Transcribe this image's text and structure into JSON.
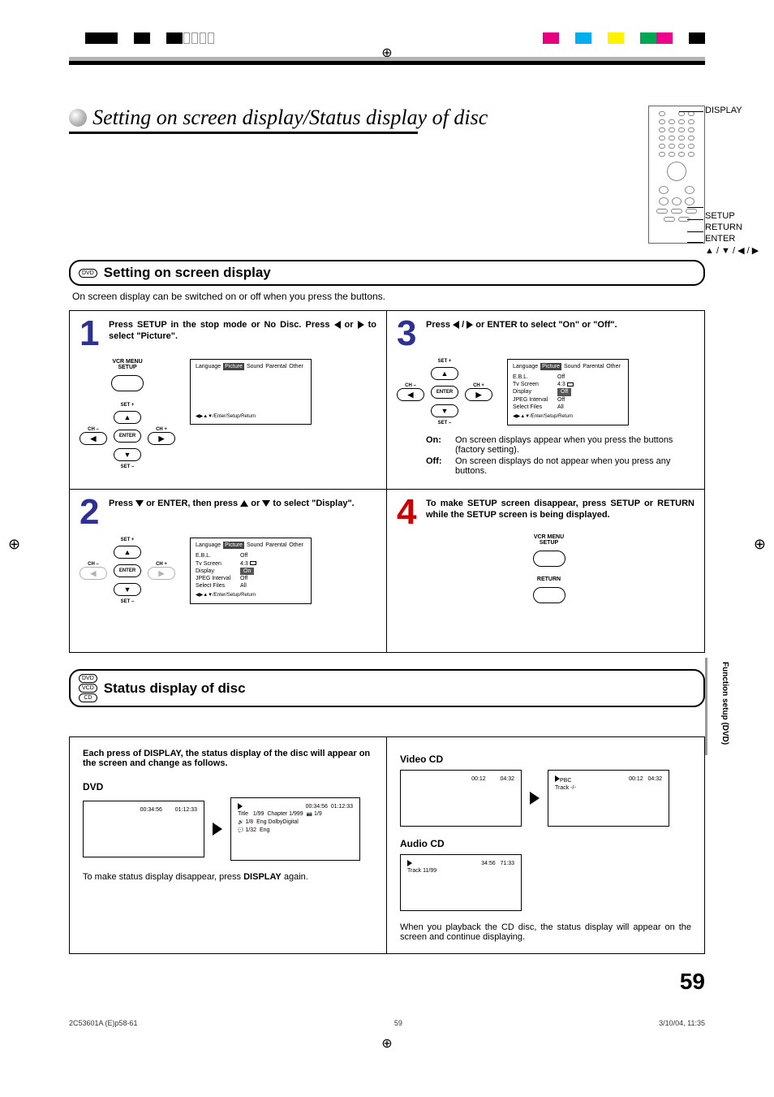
{
  "header": {
    "main_title": "Setting on screen display/Status display of disc"
  },
  "remote": {
    "labels": {
      "display": "DISPLAY",
      "setup": "SETUP",
      "return": "RETURN",
      "enter": "ENTER",
      "arrows": "▲ / ▼ / ◀ / ▶"
    }
  },
  "section1": {
    "badge": "DVD",
    "title": "Setting on screen display",
    "intro": "On screen display can be switched on or off when you press the buttons."
  },
  "steps": {
    "s1": {
      "num": "1",
      "text_a": "Press SETUP in the stop mode or No Disc. Press ",
      "text_b": " or ",
      "text_c": " to select \"Picture\".",
      "btn_label1": "VCR MENU",
      "btn_label2": "SETUP",
      "set_plus": "SET +",
      "set_minus": "SET –",
      "ch_minus": "CH –",
      "ch_plus": "CH +",
      "enter": "ENTER",
      "screen_footer": "◀▶▲▼/Enter/Setup/Return",
      "tabs": {
        "language": "Language",
        "picture": "Picture",
        "sound": "Sound",
        "parental": "Parental",
        "other": "Other"
      }
    },
    "s2": {
      "num": "2",
      "text_a": "Press ",
      "text_b": " or ENTER, then press ",
      "text_c": " or ",
      "text_d": " to select \"Display\".",
      "settings": {
        "ebl": {
          "lbl": "E.B.L.",
          "val": "Off"
        },
        "tv": {
          "lbl": "Tv Screen",
          "val": "4:3"
        },
        "display": {
          "lbl": "Display",
          "val": "On"
        },
        "jpeg": {
          "lbl": "JPEG Interval",
          "val": "Off"
        },
        "files": {
          "lbl": "Select Files",
          "val": "All"
        }
      }
    },
    "s3": {
      "num": "3",
      "text_a": "Press ",
      "text_b": " / ",
      "text_c": " or ENTER to select \"On\" or \"Off\".",
      "on_label": "On:",
      "on_text": "On screen displays appear when you press the buttons (factory setting).",
      "off_label": "Off:",
      "off_text": "On screen displays do not appear when you press any buttons.",
      "display_val": "Off"
    },
    "s4": {
      "num": "4",
      "text": "To make SETUP screen disappear, press SETUP or RETURN while the SETUP screen is being displayed.",
      "btn_label1": "VCR MENU",
      "btn_label2": "SETUP",
      "btn_label3": "RETURN"
    }
  },
  "section2": {
    "badges": {
      "dvd": "DVD",
      "vcd": "VCD",
      "cd": "CD"
    },
    "title": "Status display of disc",
    "left_intro": "Each press of DISPLAY, the status display of the disc will appear on the screen and change as follows.",
    "dvd_label": "DVD",
    "dvd_screen1": {
      "t1": "00:34:56",
      "t2": "01:12:33"
    },
    "dvd_screen2": {
      "t1": "00:34:56",
      "t2": "01:12:33",
      "line2a": "Title",
      "line2b": "1/99",
      "line2c": "Chapter 1/999",
      "line2d": "1/9",
      "line3a": "1/8",
      "line3b": "Eng DolbyDigital",
      "line4a": "1/32",
      "line4b": "Eng"
    },
    "left_note_a": "To make status display disappear, press ",
    "left_note_b": "DISPLAY",
    "left_note_c": " again.",
    "vcd_label": "Video CD",
    "vcd_screen1": {
      "t1": "00:12",
      "t2": "04:32"
    },
    "vcd_screen2": {
      "pbc": "PBC",
      "track": "Track -/-",
      "t1": "00:12",
      "t2": "04:32"
    },
    "acd_label": "Audio CD",
    "acd_screen": {
      "track": "Track 11/99",
      "t1": "34:56",
      "t2": "71:33"
    },
    "right_note": "When you playback the CD disc, the status display will appear on the screen and continue displaying."
  },
  "side_tab": "Function setup (DVD)",
  "page_number": "59",
  "footer": {
    "doc": "2C53601A (E)p58-61",
    "page": "59",
    "date": "3/10/04, 11:35"
  }
}
